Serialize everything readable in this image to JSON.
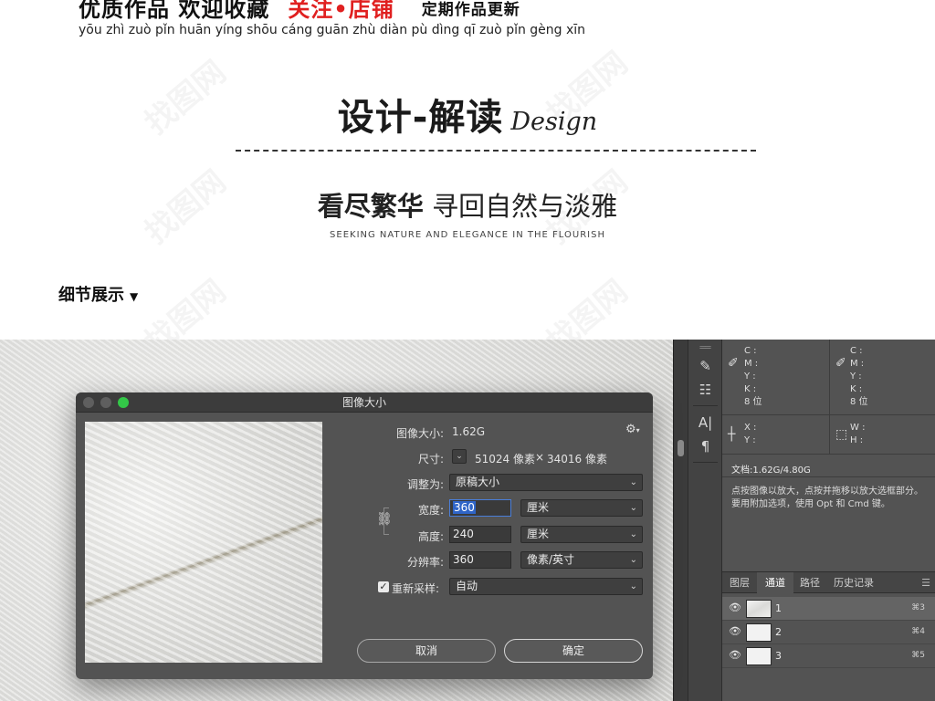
{
  "banner": {
    "headline_main": "优质作品 欢迎收藏",
    "headline_red": "关注•店铺",
    "headline_small": "定期作品更新",
    "pinyin": "yōu zhì zuò pǐn huān yíng shōu cáng guān zhù diàn pù dìng qī zuò pǐn gèng xīn",
    "design_cn": "设计-解读",
    "design_en": "Design",
    "subtitle_bold": "看尽繁华",
    "subtitle_rest": " 寻回自然与淡雅",
    "subtitle_en": "SEEKING NATURE AND ELEGANCE IN THE FLOURISH",
    "detail_label": "细节展示",
    "detail_arrow": "▼"
  },
  "dialog": {
    "title": "图像大小",
    "image_size_label": "图像大小:",
    "image_size_value": "1.62G",
    "dimensions_label": "尺寸:",
    "dimensions_width": "51024 像素",
    "dimensions_times": "×",
    "dimensions_height": "34016 像素",
    "fit_label": "调整为:",
    "fit_value": "原稿大小",
    "width_label": "宽度:",
    "width_value": "360",
    "width_unit": "厘米",
    "height_label": "高度:",
    "height_value": "240",
    "height_unit": "厘米",
    "resolution_label": "分辨率:",
    "resolution_value": "360",
    "resolution_unit": "像素/英寸",
    "resample_label": "重新采样:",
    "resample_checked": true,
    "resample_value": "自动",
    "cancel_label": "取消",
    "ok_label": "确定"
  },
  "info_panel": {
    "cmyk_left": "C :\nM :\nY :\nK :\n8 位",
    "cmyk_right": "C :\nM :\nY :\nK :\n8 位",
    "xy": "X :\nY :",
    "wh": "W :\nH :",
    "doc": "文档:1.62G/4.80G",
    "hint": "点按图像以放大，点按并拖移以放大选框部分。要用附加选项，使用 Opt 和 Cmd 键。"
  },
  "panel_tabs": [
    "图层",
    "通道",
    "路径",
    "历史记录"
  ],
  "active_tab": "通道",
  "channels": [
    {
      "name": "1",
      "shortcut": "⌘3",
      "active": true
    },
    {
      "name": "2",
      "shortcut": "⌘4",
      "active": false
    },
    {
      "name": "3",
      "shortcut": "⌘5",
      "active": false
    }
  ],
  "icons": {
    "gear": "gear-icon",
    "link": "link-icon",
    "eyedropper": "eyedropper-icon",
    "crosshair": "crosshair-icon",
    "eye": "eye-icon",
    "panel_menu": "panel-menu-icon"
  },
  "colors": {
    "accent_red": "#e02020",
    "mac_green": "#33c748",
    "ps_panel": "#535353",
    "selection_blue": "#2f65c8"
  }
}
